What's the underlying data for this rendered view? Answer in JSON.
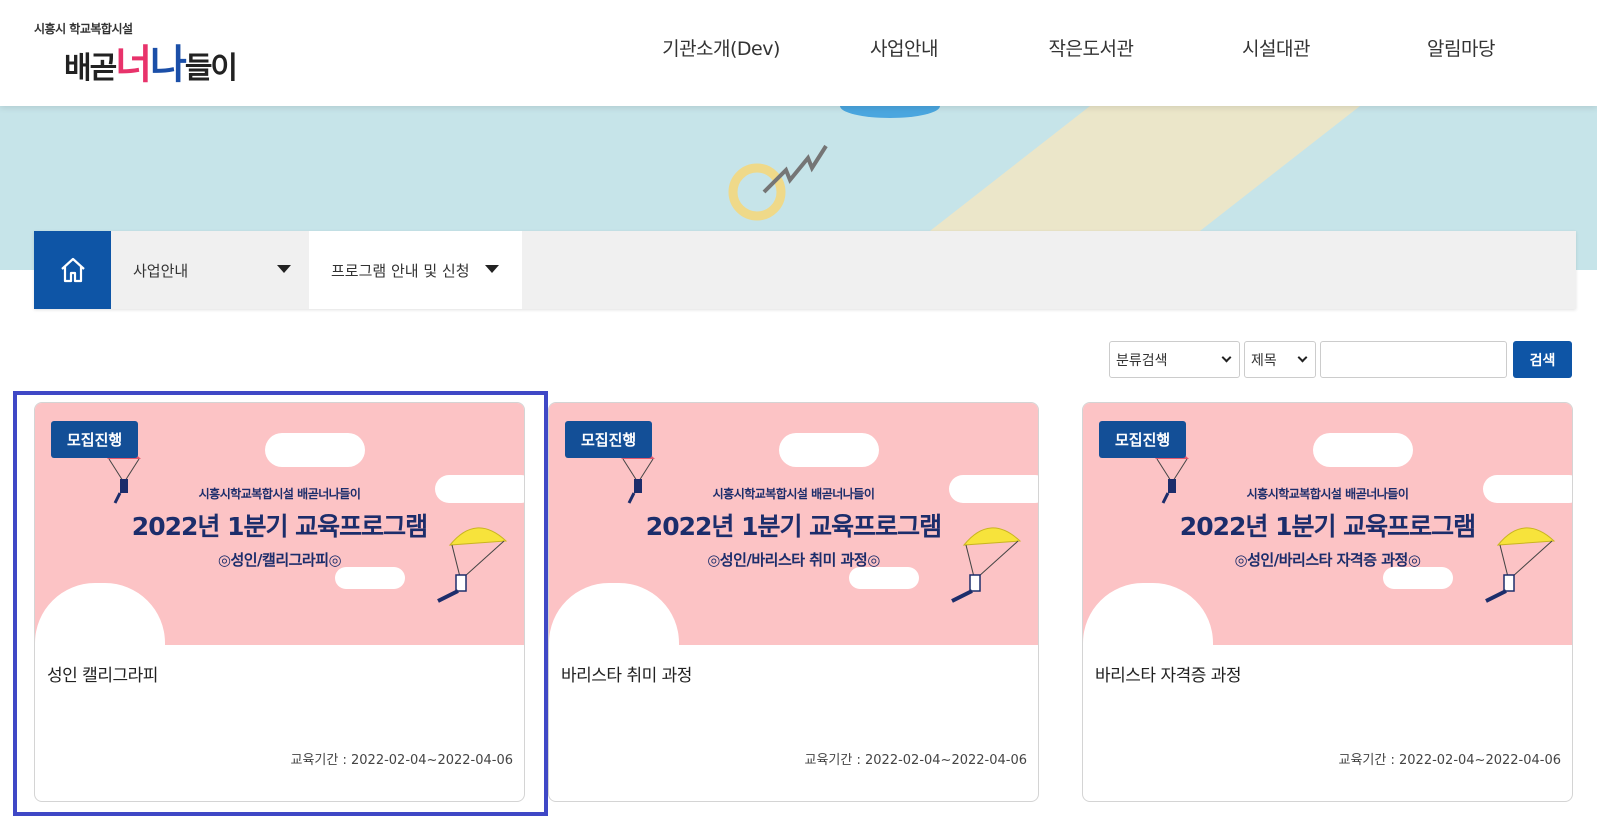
{
  "header": {
    "logo_small": "시흥시 학교복합시설",
    "logo_word_1": "배곧",
    "logo_word_2": "너",
    "logo_word_3": "나",
    "logo_word_4": "들이",
    "nav": [
      "기관소개(Dev)",
      "사업안내",
      "작은도서관",
      "시설대관",
      "알림마당"
    ]
  },
  "breadcrumb": {
    "home_icon": "home-icon",
    "level1": "사업안내",
    "level2": "프로그램 안내 및 신청"
  },
  "search": {
    "category_select": "분류검색",
    "field_select": "제목",
    "query": "",
    "button": "검색"
  },
  "cards": [
    {
      "badge": "모집진행",
      "poster_small": "시흥시학교복합시설 배곧너나들이",
      "poster_big": "2022년 1분기 교육프로그램",
      "poster_sub": "◎성인/캘리그라피◎",
      "title": "성인 캘리그라피",
      "period": "교육기간 : 2022-02-04~2022-04-06"
    },
    {
      "badge": "모집진행",
      "poster_small": "시흥시학교복합시설 배곧너나들이",
      "poster_big": "2022년 1분기 교육프로그램",
      "poster_sub": "◎성인/바리스타 취미 과정◎",
      "title": "바리스타 취미 과정",
      "period": "교육기간 : 2022-02-04~2022-04-06"
    },
    {
      "badge": "모집진행",
      "poster_small": "시흥시학교복합시설 배곧너나들이",
      "poster_big": "2022년 1분기 교육프로그램",
      "poster_sub": "◎성인/바리스타 자격증 과정◎",
      "title": "바리스타 자격증 과정",
      "period": "교육기간 : 2022-02-04~2022-04-06"
    }
  ],
  "colors": {
    "brand_blue": "#0e55a6",
    "badge_blue": "#134f97",
    "poster_pink": "#fcc3c5",
    "banner_teal": "#c6e4e9",
    "selection_outline": "#3f48c6"
  }
}
